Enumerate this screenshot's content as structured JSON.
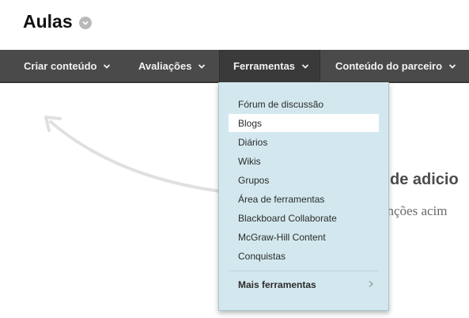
{
  "page": {
    "title": "Aulas"
  },
  "nav": {
    "items": [
      {
        "label": "Criar conteúdo"
      },
      {
        "label": "Avaliações"
      },
      {
        "label": "Ferramentas"
      },
      {
        "label": "Conteúdo do parceiro"
      }
    ],
    "active_index": 2
  },
  "dropdown": {
    "items": [
      {
        "label": "Fórum de discussão"
      },
      {
        "label": "Blogs"
      },
      {
        "label": "Diários"
      },
      {
        "label": "Wikis"
      },
      {
        "label": "Grupos"
      },
      {
        "label": "Área de ferramentas"
      },
      {
        "label": "Blackboard Collaborate"
      },
      {
        "label": "McGraw-Hill Content"
      },
      {
        "label": "Conquistas"
      }
    ],
    "highlighted_index": 1,
    "more": {
      "label": "Mais ferramentas"
    }
  },
  "background": {
    "heading_fragment": "de adicio",
    "sub_fragment": "unções acim"
  },
  "colors": {
    "nav_bg": "#4a4a4a",
    "dropdown_bg": "#d3e8ee",
    "highlight_bg": "#ffffff"
  }
}
